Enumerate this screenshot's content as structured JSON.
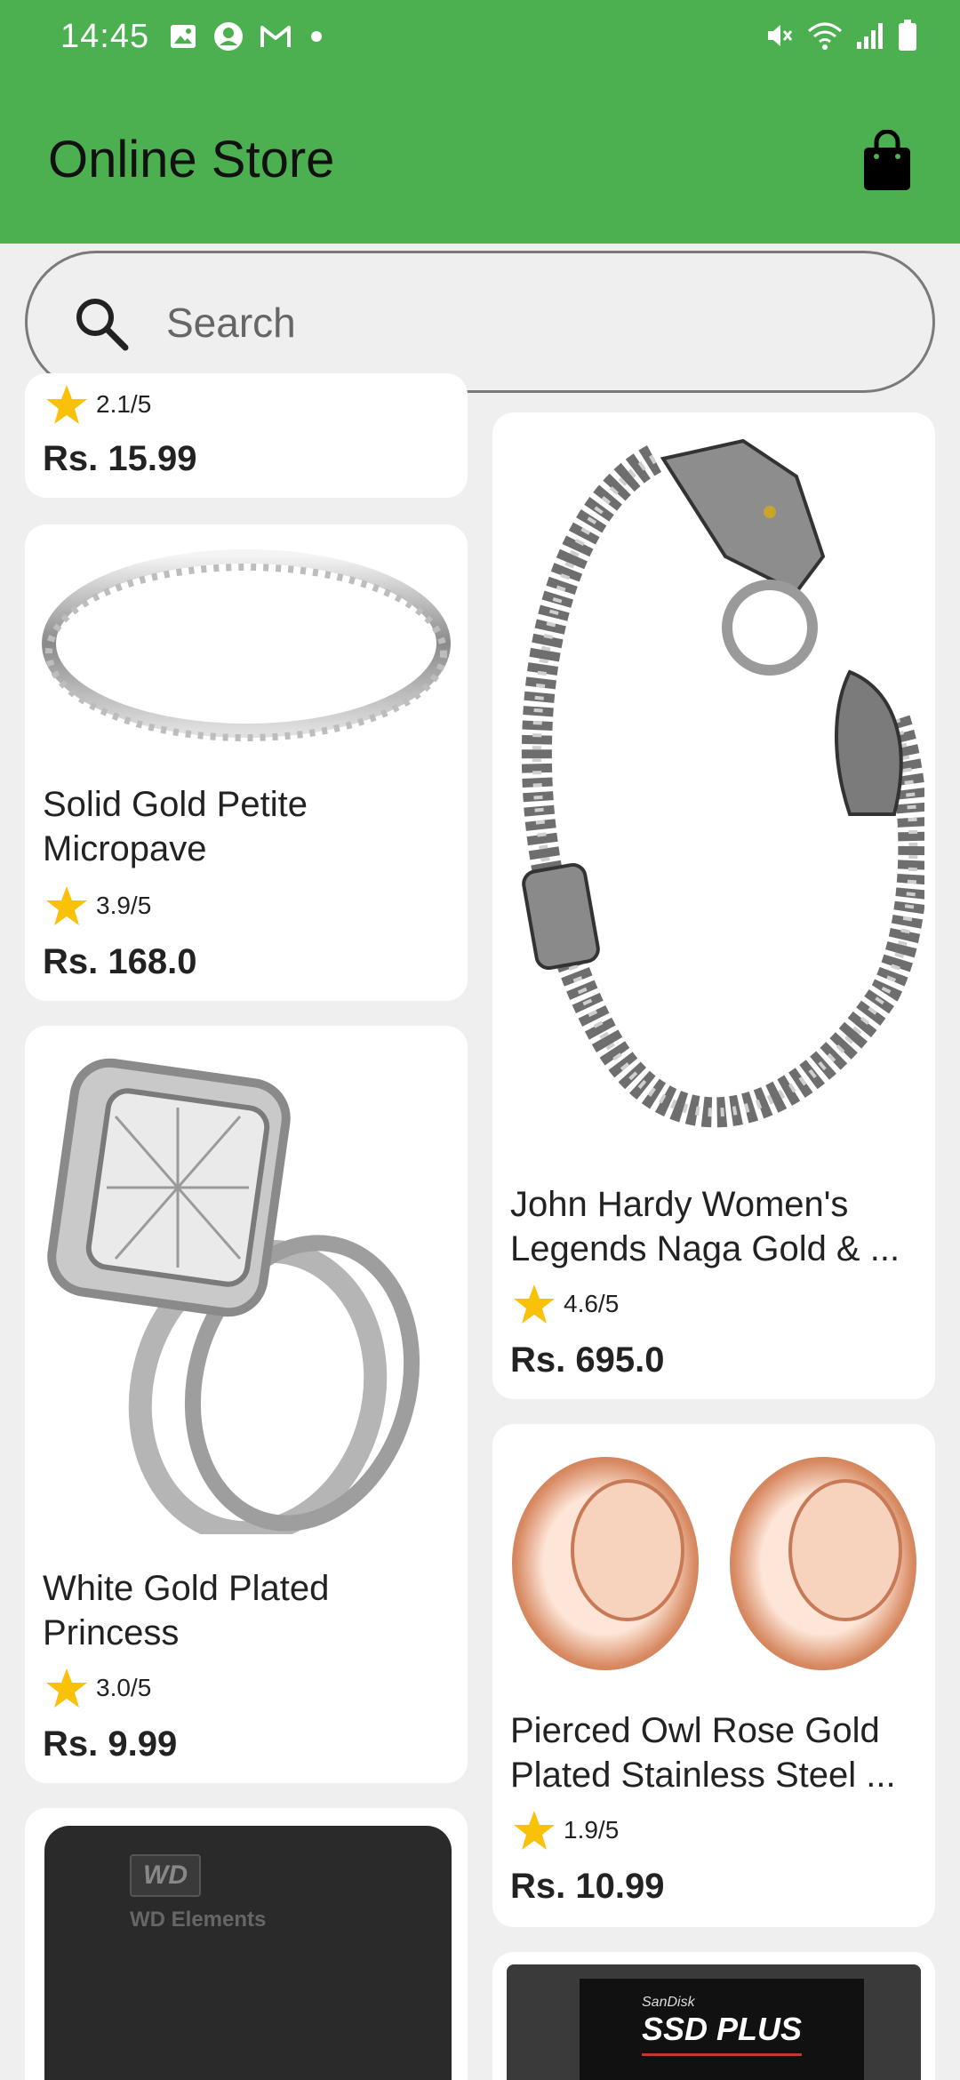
{
  "status_bar": {
    "time": "14:45"
  },
  "app_bar": {
    "title": "Online Store"
  },
  "search": {
    "placeholder": "Search"
  },
  "products": [
    {
      "title": "",
      "rating": "2.1/5",
      "price": "Rs. 15.99",
      "image_icon": "product-image"
    },
    {
      "title_lines": [
        "Solid Gold Petite",
        "Micropave"
      ],
      "rating": "3.9/5",
      "price": "Rs. 168.0",
      "image_icon": "silver-ring-image"
    },
    {
      "title_lines": [
        "John Hardy Women's",
        "Legends Naga Gold & ..."
      ],
      "rating": "4.6/5",
      "price": "Rs. 695.0",
      "image_icon": "dragon-bracelet-image"
    },
    {
      "title_lines": [
        "White Gold Plated",
        "Princess"
      ],
      "rating": "3.0/5",
      "price": "Rs. 9.99",
      "image_icon": "diamond-ring-set-image"
    },
    {
      "title_lines": [
        "Pierced Owl Rose Gold",
        "Plated Stainless Steel ..."
      ],
      "rating": "1.9/5",
      "price": "Rs. 10.99",
      "image_icon": "rose-gold-tunnels-image"
    },
    {
      "image_text": "WD Elements",
      "image_icon": "external-hdd-image"
    },
    {
      "image_text_small": "SanDisk",
      "image_text": "SSD PLUS",
      "image_icon": "ssd-image"
    }
  ],
  "colors": {
    "app_bar": "#4caf50",
    "background": "#efefef",
    "star": "#f9c10a"
  }
}
